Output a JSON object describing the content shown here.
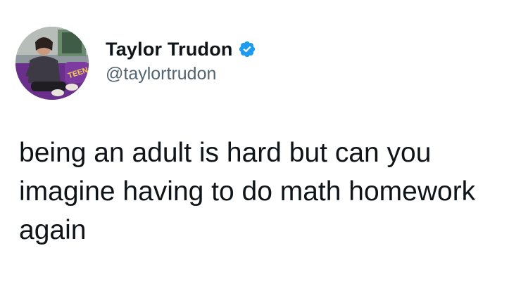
{
  "tweet": {
    "author": {
      "display_name": "Taylor Trudon",
      "handle": "@taylortrudon",
      "verified": true,
      "verified_icon": "verified-badge-icon",
      "avatar_badge_text": "TEEN"
    },
    "text": "being an adult is hard but can you\nimagine having to do math homework\nagain"
  },
  "colors": {
    "verified": "#1d9bf0",
    "handle": "#536471",
    "text": "#0f1419",
    "background": "#ffffff"
  }
}
